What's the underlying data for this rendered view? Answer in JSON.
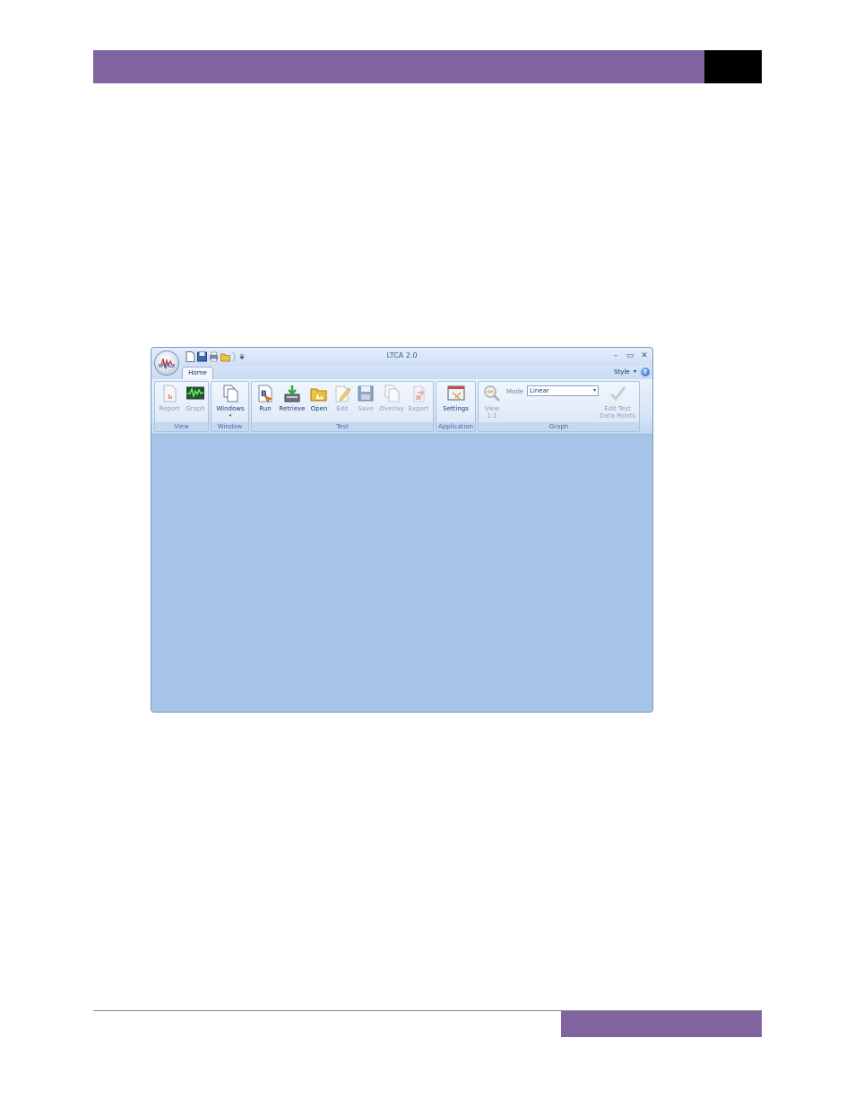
{
  "window": {
    "title": "LTCA 2.0",
    "minimize": "–",
    "maximize": "▭",
    "close": "✕"
  },
  "tabs": [
    {
      "label": "Home"
    }
  ],
  "style_menu": {
    "label": "Style",
    "caret": "▾"
  },
  "help": {
    "glyph": "?"
  },
  "groups": {
    "view": {
      "label": "View",
      "buttons": [
        {
          "label": "Report"
        },
        {
          "label": "Graph"
        }
      ]
    },
    "window": {
      "label": "Window",
      "buttons": [
        {
          "label": "Windows",
          "caret": "▾"
        }
      ]
    },
    "test": {
      "label": "Test",
      "buttons": [
        {
          "label": "Run"
        },
        {
          "label": "Retrieve"
        },
        {
          "label": "Open"
        },
        {
          "label": "Edit"
        },
        {
          "label": "Save"
        },
        {
          "label": "Overlay"
        },
        {
          "label": "Export"
        }
      ]
    },
    "application": {
      "label": "Application",
      "buttons": [
        {
          "label": "Settings"
        }
      ]
    },
    "graph": {
      "label": "Graph",
      "view_button": {
        "line1": "View",
        "line2": "1:1"
      },
      "mode_label": "Mode",
      "mode_value": "Linear",
      "mode_caret": "▾",
      "edit_button": {
        "line1": "Edit Test",
        "line2": "Data Points"
      }
    }
  },
  "colors": {
    "page_accent": "#8064a2",
    "window_client": "#a6c3e8",
    "ribbon_label": "#4a6ea3"
  }
}
